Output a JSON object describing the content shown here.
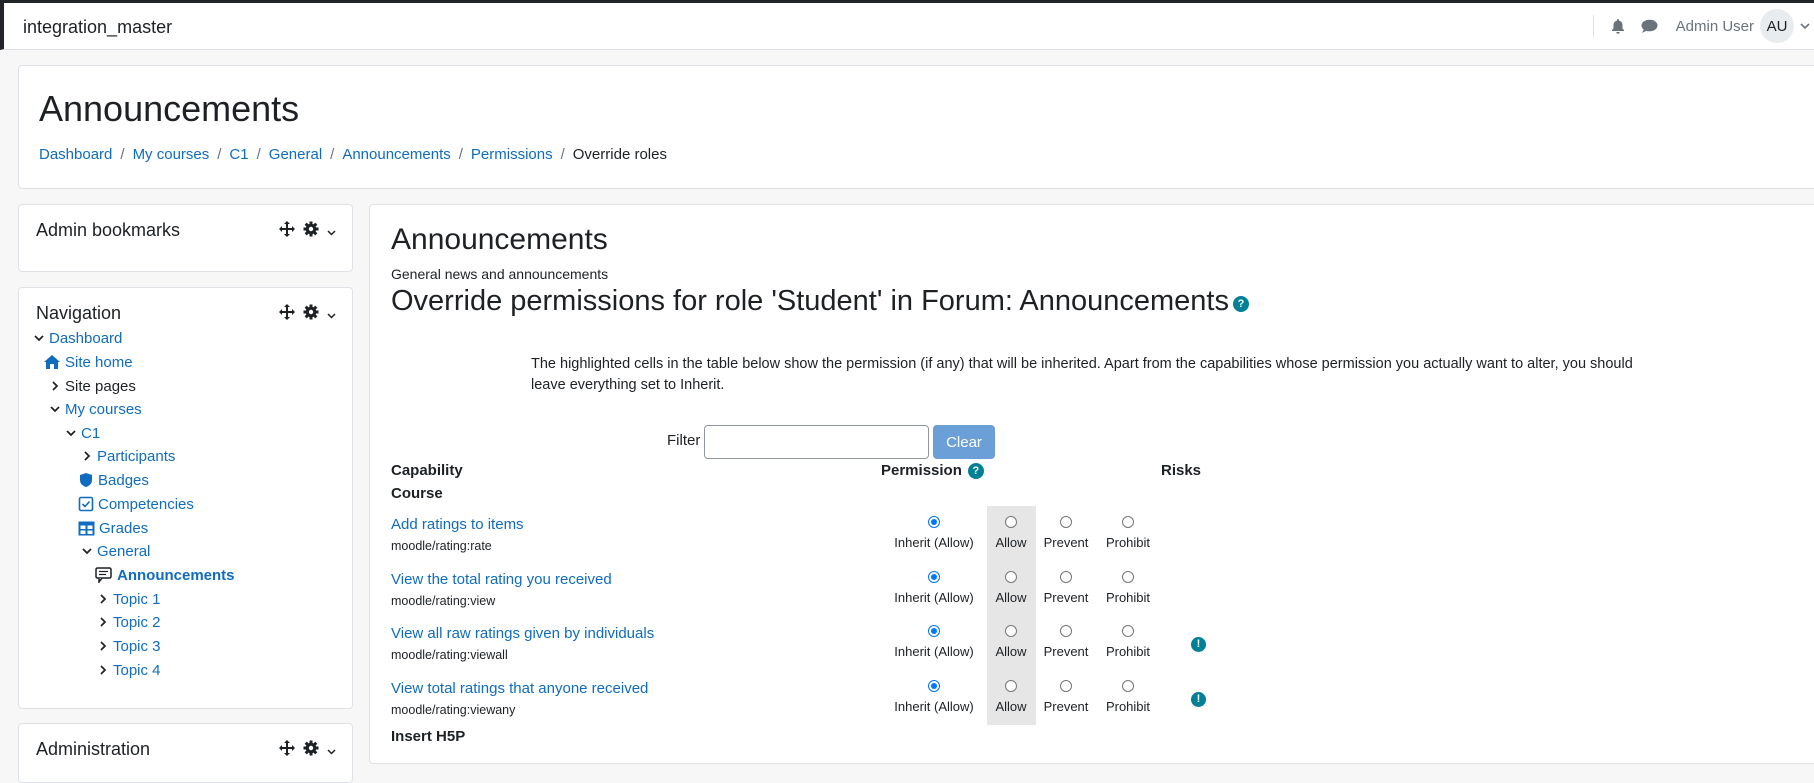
{
  "app": {
    "site_name": "integration_master",
    "user_name": "Admin User",
    "user_initials": "AU"
  },
  "header": {
    "title": "Announcements",
    "breadcrumb": [
      "Dashboard",
      "My courses",
      "C1",
      "General",
      "Announcements",
      "Permissions",
      "Override roles"
    ]
  },
  "blocks": {
    "admin_bookmarks": {
      "title": "Admin bookmarks"
    },
    "navigation": {
      "title": "Navigation",
      "items": [
        "Dashboard",
        "Site home",
        "Site pages",
        "My courses",
        "C1",
        "Participants",
        "Badges",
        "Competencies",
        "Grades",
        "General",
        "Announcements",
        "Topic 1",
        "Topic 2",
        "Topic 3",
        "Topic 4"
      ]
    },
    "administration": {
      "title": "Administration"
    }
  },
  "main": {
    "heading": "Announcements",
    "intro": "General news and announcements",
    "override_title": "Override permissions for role 'Student' in Forum: Announcements",
    "explanation": "The highlighted cells in the table below show the permission (if any) that will be inherited. Apart from the capabilities whose permission you actually want to alter, you should leave everything set to Inherit.",
    "filter_label": "Filter",
    "filter_value": "",
    "clear_label": "Clear",
    "columns": {
      "capability": "Capability",
      "permission": "Permission",
      "risks": "Risks"
    },
    "groups": [
      "Course",
      "Insert H5P"
    ],
    "options": [
      "Inherit (Allow)",
      "Allow",
      "Prevent",
      "Prohibit"
    ],
    "rows": [
      {
        "name": "Add ratings to items",
        "code": "moodle/rating:rate",
        "selected": "Inherit (Allow)",
        "risk": false
      },
      {
        "name": "View the total rating you received",
        "code": "moodle/rating:view",
        "selected": "Inherit (Allow)",
        "risk": false
      },
      {
        "name": "View all raw ratings given by individuals",
        "code": "moodle/rating:viewall",
        "selected": "Inherit (Allow)",
        "risk": true
      },
      {
        "name": "View total ratings that anyone received",
        "code": "moodle/rating:viewany",
        "selected": "Inherit (Allow)",
        "risk": true
      }
    ]
  },
  "colors": {
    "link": "#0f6cbf",
    "help": "#008196",
    "clear_button": "#6a9fd8",
    "highlight": "#e6e6e6"
  },
  "icons": [
    "bell-icon",
    "chat-icon",
    "move-icon",
    "gear-icon",
    "chevron-down-icon",
    "home-icon",
    "shield-icon",
    "checkbox-icon",
    "grid-icon",
    "forum-icon",
    "chevron-right-icon",
    "help-icon",
    "risk-icon"
  ]
}
